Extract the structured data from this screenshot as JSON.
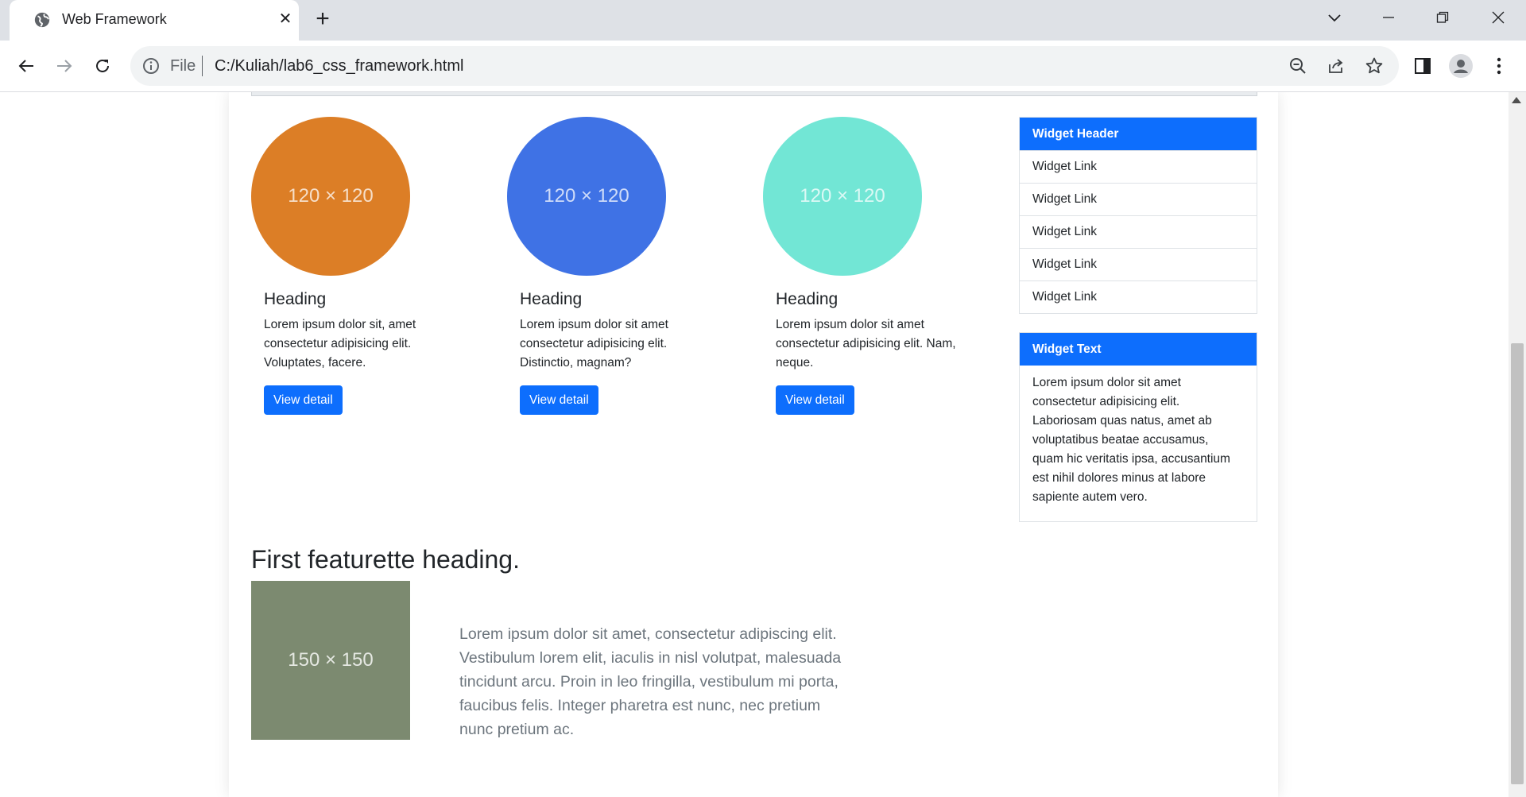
{
  "browser": {
    "tab_title": "Web Framework",
    "tab_close": "✕",
    "new_tab": "+",
    "address_scheme": "File",
    "address_url": "C:/Kuliah/lab6_css_framework.html"
  },
  "cards": [
    {
      "image_label": "120 × 120",
      "color": "#dc7e26",
      "heading": "Heading",
      "text": "Lorem ipsum dolor sit, amet consectetur adipisicing elit. Voluptates, facere.",
      "button": "View detail"
    },
    {
      "image_label": "120 × 120",
      "color": "#3f72e5",
      "heading": "Heading",
      "text": "Lorem ipsum dolor sit amet consectetur adipisicing elit. Distinctio, magnam?",
      "button": "View detail"
    },
    {
      "image_label": "120 × 120",
      "color": "#72e6d5",
      "heading": "Heading",
      "text": "Lorem ipsum dolor sit amet consectetur adipisicing elit. Nam, neque.",
      "button": "View detail"
    }
  ],
  "widgets": {
    "links_header": "Widget Header",
    "links": [
      "Widget Link",
      "Widget Link",
      "Widget Link",
      "Widget Link",
      "Widget Link"
    ],
    "text_header": "Widget Text",
    "text_body": "Lorem ipsum dolor sit amet consectetur adipisicing elit. Laboriosam quas natus, amet ab voluptatibus beatae accusamus, quam hic veritatis ipsa, accusantium est nihil dolores minus at labore sapiente autem vero."
  },
  "featurette": {
    "heading": "First featurette heading.",
    "image_label": "150 × 150",
    "image_color": "#7c8a70",
    "lead": "Lorem ipsum dolor sit amet, consectetur adipiscing elit. Vestibulum lorem elit, iaculis in nisl volutpat, malesuada tincidunt arcu. Proin in leo fringilla, vestibulum mi porta, faucibus felis. Integer pharetra est nunc, nec pretium nunc pretium ac."
  },
  "colors": {
    "primary": "#0d6efd",
    "chrome_bg": "#dee1e6"
  }
}
